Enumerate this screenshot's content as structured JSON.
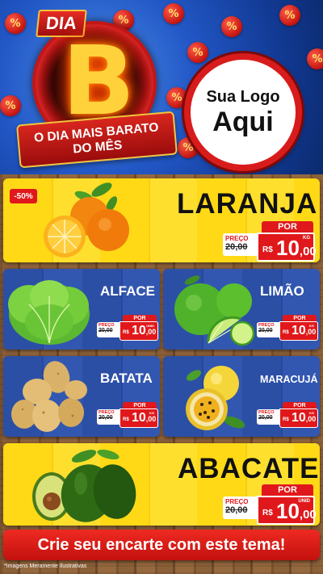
{
  "header": {
    "badge_dia": "DIA",
    "badge_letter": "B",
    "ribbon_line1": "O DIA MAIS BARATO",
    "ribbon_line2": "DO MÊS",
    "percent_symbol": "%",
    "logo_line1": "Sua Logo",
    "logo_line2": "Aqui"
  },
  "colors": {
    "red": "#e0181b",
    "yellow_panel": "#ffd915",
    "blue_panel": "#2c4fa6",
    "header_blue": "#2257c6"
  },
  "products": [
    {
      "name": "LARANJA",
      "discount": "-50%",
      "por_label": "POR",
      "preco_label": "PREÇO",
      "old_price": "20,00",
      "currency": "R$",
      "price_int": "10",
      "price_dec": ",00",
      "unit": "KG"
    },
    {
      "name": "ALFACE",
      "por_label": "POR",
      "preco_label": "PREÇO",
      "old_price": "20,00",
      "currency": "R$",
      "price_int": "10",
      "price_dec": ",00",
      "unit": "UNID"
    },
    {
      "name": "LIMÃO",
      "por_label": "POR",
      "preco_label": "PREÇO",
      "old_price": "20,00",
      "currency": "R$",
      "price_int": "10",
      "price_dec": ",00",
      "unit": "KG"
    },
    {
      "name": "BATATA",
      "por_label": "POR",
      "preco_label": "PREÇO",
      "old_price": "20,00",
      "currency": "R$",
      "price_int": "10",
      "price_dec": ",00",
      "unit": "KG"
    },
    {
      "name": "MARACUJÁ",
      "por_label": "POR",
      "preco_label": "PREÇO",
      "old_price": "20,00",
      "currency": "R$",
      "price_int": "10",
      "price_dec": ",00",
      "unit": "KG"
    },
    {
      "name": "ABACATE",
      "por_label": "POR",
      "preco_label": "PREÇO",
      "old_price": "20,00",
      "currency": "R$",
      "price_int": "10",
      "price_dec": ",00",
      "unit": "UNID"
    }
  ],
  "cta": "Crie seu encarte com este tema!",
  "footnote": "*Imagens Meramente Ilustrativas"
}
